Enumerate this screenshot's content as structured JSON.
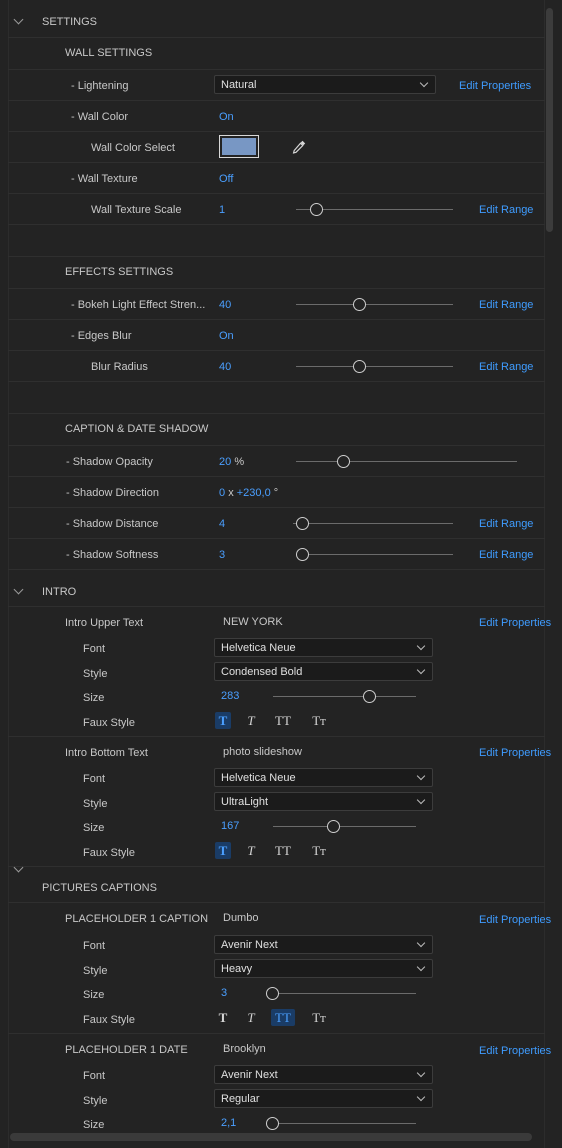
{
  "settings": {
    "title": "SETTINGS",
    "wall": {
      "header": "WALL SETTINGS",
      "lightening_label": "- Lightening",
      "lightening_value": "Natural",
      "lightening_action": "Edit Properties",
      "wall_color_label": "- Wall Color",
      "wall_color_value": "On",
      "wall_color_select_label": "Wall Color Select",
      "wall_color_swatch": "#7897c4",
      "wall_texture_label": "- Wall Texture",
      "wall_texture_value": "Off",
      "texture_scale_label": "Wall Texture Scale",
      "texture_scale_value": "1",
      "texture_scale_action": "Edit Range"
    },
    "effects": {
      "header": "EFFECTS SETTINGS",
      "bokeh_label": "- Bokeh Light Effect Stren...",
      "bokeh_value": "40",
      "bokeh_action": "Edit Range",
      "edges_label": "- Edges Blur",
      "edges_value": "On",
      "blur_radius_label": "Blur Radius",
      "blur_radius_value": "40",
      "blur_radius_action": "Edit Range"
    },
    "shadow": {
      "header": "CAPTION & DATE SHADOW",
      "opacity_label": "- Shadow Opacity",
      "opacity_value": "20",
      "opacity_unit": "%",
      "direction_label": "- Shadow Direction",
      "direction_value": "0",
      "direction_sep": "x",
      "direction_angle": "+230,0",
      "direction_unit": "°",
      "distance_label": "- Shadow Distance",
      "distance_value": "4",
      "distance_action": "Edit Range",
      "softness_label": "- Shadow Softness",
      "softness_value": "3",
      "softness_action": "Edit Range"
    }
  },
  "intro": {
    "title": "INTRO",
    "upper": {
      "label": "Intro Upper Text",
      "text": "NEW YORK",
      "action": "Edit Properties",
      "font_label": "Font",
      "font": "Helvetica Neue",
      "style_label": "Style",
      "style": "Condensed Bold",
      "size_label": "Size",
      "size": "283",
      "faux_label": "Faux Style"
    },
    "bottom": {
      "label": "Intro Bottom Text",
      "text": "photo slideshow",
      "action": "Edit Properties",
      "font_label": "Font",
      "font": "Helvetica Neue",
      "style_label": "Style",
      "style": "UltraLight",
      "size_label": "Size",
      "size": "167",
      "faux_label": "Faux Style"
    }
  },
  "captions": {
    "title": "PICTURES CAPTIONS",
    "caption1": {
      "label": "PLACEHOLDER 1 CAPTION",
      "text": "Dumbo",
      "action": "Edit Properties",
      "font_label": "Font",
      "font": "Avenir Next",
      "style_label": "Style",
      "style": "Heavy",
      "size_label": "Size",
      "size": "3",
      "faux_label": "Faux Style"
    },
    "date1": {
      "label": "PLACEHOLDER 1 DATE",
      "text": "Brooklyn",
      "action": "Edit Properties",
      "font_label": "Font",
      "font": "Avenir Next",
      "style_label": "Style",
      "style": "Regular",
      "size_label": "Size",
      "size": "2,1"
    }
  },
  "faux_glyphs": {
    "bold": "T",
    "italic": "T",
    "allcaps": "TT",
    "smallcaps": "Tт"
  },
  "sliders": {
    "texture_scale": 0.1,
    "bokeh": 0.4,
    "blur_radius": 0.4,
    "shadow_opacity": 0.2,
    "shadow_distance": 0.02,
    "shadow_softness": 0.0,
    "intro_upper_size": 0.7,
    "intro_bottom_size": 0.42,
    "caption1_size": 0.0,
    "date1_size": 0.0
  },
  "colors": {
    "accent": "#4a9fff",
    "background": "#232323"
  }
}
